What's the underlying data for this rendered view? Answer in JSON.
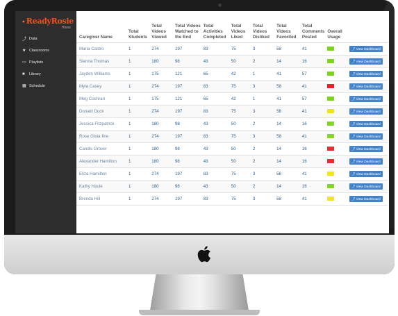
{
  "brand": {
    "name": "ReadyRosie",
    "tagline": "Home"
  },
  "sidebar": {
    "items": [
      {
        "label": "Data",
        "icon": "chart-icon"
      },
      {
        "label": "Classrooms",
        "icon": "star-icon"
      },
      {
        "label": "Playlists",
        "icon": "monitor-icon"
      },
      {
        "label": "Library",
        "icon": "video-icon"
      },
      {
        "label": "Schedule",
        "icon": "calendar-icon"
      }
    ]
  },
  "table": {
    "headers": [
      "Caregiver Name",
      "Total Students",
      "Total Videos Viewed",
      "Total Videos Watched to the End",
      "Total Activities Completed",
      "Total Videos Liked",
      "Total Videos Disliked",
      "Total Videos Favorited",
      "Total Comments Posted",
      "Overall Usage",
      ""
    ],
    "button_label": "View Dashboard",
    "rows": [
      {
        "name": "Maria Castro",
        "students": "1",
        "viewed": "274",
        "watched": "197",
        "activities": "83",
        "liked": "75",
        "disliked": "3",
        "favorited": "58",
        "comments": "41",
        "usage": "green"
      },
      {
        "name": "Sienna Thomas",
        "students": "1",
        "viewed": "180",
        "watched": "98",
        "activities": "43",
        "liked": "50",
        "disliked": "2",
        "favorited": "14",
        "comments": "16",
        "usage": "green"
      },
      {
        "name": "Jayden Williams",
        "students": "1",
        "viewed": "175",
        "watched": "121",
        "activities": "65",
        "liked": "42",
        "disliked": "1",
        "favorited": "41",
        "comments": "57",
        "usage": "green"
      },
      {
        "name": "Myla Casey",
        "students": "1",
        "viewed": "274",
        "watched": "197",
        "activities": "83",
        "liked": "75",
        "disliked": "3",
        "favorited": "58",
        "comments": "41",
        "usage": "red"
      },
      {
        "name": "Meg Cochran",
        "students": "1",
        "viewed": "175",
        "watched": "121",
        "activities": "65",
        "liked": "42",
        "disliked": "1",
        "favorited": "41",
        "comments": "57",
        "usage": "green"
      },
      {
        "name": "Donald Duck",
        "students": "1",
        "viewed": "274",
        "watched": "197",
        "activities": "83",
        "liked": "75",
        "disliked": "3",
        "favorited": "58",
        "comments": "41",
        "usage": "yellow"
      },
      {
        "name": "Jessica Fitzpatrick",
        "students": "1",
        "viewed": "180",
        "watched": "98",
        "activities": "43",
        "liked": "50",
        "disliked": "2",
        "favorited": "14",
        "comments": "16",
        "usage": "green"
      },
      {
        "name": "Rose Gloia fine",
        "students": "1",
        "viewed": "274",
        "watched": "197",
        "activities": "83",
        "liked": "75",
        "disliked": "3",
        "favorited": "58",
        "comments": "41",
        "usage": "green"
      },
      {
        "name": "Candis Grover",
        "students": "1",
        "viewed": "180",
        "watched": "98",
        "activities": "43",
        "liked": "50",
        "disliked": "2",
        "favorited": "14",
        "comments": "16",
        "usage": "red"
      },
      {
        "name": "Alexander Hamilton",
        "students": "1",
        "viewed": "180",
        "watched": "98",
        "activities": "43",
        "liked": "50",
        "disliked": "2",
        "favorited": "14",
        "comments": "16",
        "usage": "red"
      },
      {
        "name": "Eliza Hamilton",
        "students": "1",
        "viewed": "274",
        "watched": "197",
        "activities": "83",
        "liked": "75",
        "disliked": "3",
        "favorited": "58",
        "comments": "41",
        "usage": "yellow"
      },
      {
        "name": "Kathy Haule",
        "students": "1",
        "viewed": "180",
        "watched": "98",
        "activities": "43",
        "liked": "50",
        "disliked": "2",
        "favorited": "14",
        "comments": "16",
        "usage": "green"
      },
      {
        "name": "Brenda Hill",
        "students": "1",
        "viewed": "274",
        "watched": "197",
        "activities": "83",
        "liked": "75",
        "disliked": "3",
        "favorited": "58",
        "comments": "41",
        "usage": "yellow"
      }
    ]
  },
  "colors": {
    "green": "#7ed321",
    "red": "#e8202a",
    "yellow": "#f2e21c",
    "button": "#3f7fc6",
    "brand": "#e8561f",
    "sidebar": "#2d2d2d"
  }
}
